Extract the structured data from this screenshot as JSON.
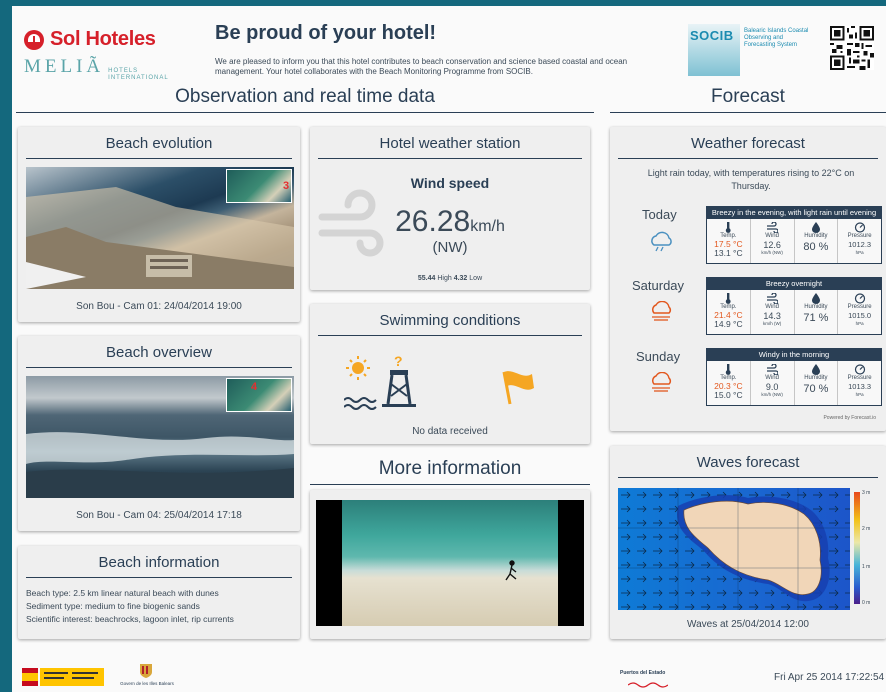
{
  "header": {
    "brand": "Sol Hoteles",
    "melia": "MELIÃ",
    "melia_sub": "HOTELS INTERNATIONAL",
    "headline": "Be proud of your hotel!",
    "intro": "We are pleased to inform you that this hotel contributes to beach conservation and science based coastal and ocean management. Your hotel collaborates with the Beach Monitoring Programme from SOCIB.",
    "socib": "SOCIB",
    "socib_sub": "Balearic Islands Coastal Observing and Forecasting System"
  },
  "sections": {
    "observation": "Observation and real time data",
    "forecast": "Forecast",
    "more_info": "More information"
  },
  "beach_evolution": {
    "title": "Beach evolution",
    "inset_number": "3",
    "caption": "Son Bou - Cam 01: 24/04/2014 19:00"
  },
  "beach_overview": {
    "title": "Beach overview",
    "inset_number": "4",
    "caption": "Son Bou - Cam 04: 25/04/2014 17:18"
  },
  "beach_information": {
    "title": "Beach information",
    "lines": [
      "Beach type: 2.5 km linear natural beach with dunes",
      "Sediment type: medium to fine biogenic sands",
      "Scientific interest: beachrocks, lagoon inlet, rip currents"
    ]
  },
  "weather_station": {
    "title": "Hotel weather station",
    "label": "Wind speed",
    "value": "26.28",
    "unit": "km/h",
    "direction": "(NW)",
    "high_value": "55.44",
    "high_label": "High",
    "low_value": "4.32",
    "low_label": "Low"
  },
  "swimming": {
    "title": "Swimming conditions",
    "status": "No data received"
  },
  "weather_forecast": {
    "title": "Weather forecast",
    "summary": "Light rain today, with temperatures rising to 22°C on Thursday.",
    "labels": {
      "temp": "Temp.",
      "wind": "Wind",
      "humidity": "Humidity",
      "pressure": "Pressure",
      "wind_unit": "km/h (NW)",
      "wind_unit_short": "km/h (W)",
      "pressure_unit": "hPa"
    },
    "days": [
      {
        "name": "Today",
        "summary": "Breezy in the evening, with light rain until evening",
        "temp_high": "17.5 °C",
        "temp_low": "13.1 °C",
        "wind": "12.6",
        "humidity": "80 %",
        "pressure": "1012.3"
      },
      {
        "name": "Saturday",
        "summary": "Breezy overnight",
        "temp_high": "21.4 °C",
        "temp_low": "14.9 °C",
        "wind": "14.3",
        "humidity": "71 %",
        "pressure": "1015.0"
      },
      {
        "name": "Sunday",
        "summary": "Windy in the morning",
        "temp_high": "20.3 °C",
        "temp_low": "15.0 °C",
        "wind": "9.0",
        "humidity": "70 %",
        "pressure": "1013.3"
      }
    ],
    "powered": "Powered by Forecast.io"
  },
  "waves_forecast": {
    "title": "Waves forecast",
    "caption": "Waves at 25/04/2014 12:00",
    "scale": [
      "3 m",
      "2 m",
      "1 m",
      "0 m"
    ]
  },
  "footer": {
    "govern": "Govern de les Illes Balears",
    "puertos": "Puertos del Estado",
    "datetime": "Fri Apr 25 2014 17:22:54"
  },
  "colors": {
    "frame": "#14687d",
    "navy": "#2a3f55",
    "brand_red": "#d6202a",
    "high_temp": "#e2581f",
    "swim_orange": "#f5a623"
  }
}
